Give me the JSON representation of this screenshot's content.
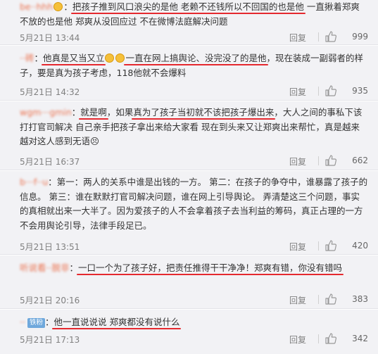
{
  "comments": [
    {
      "username": "be··hhh",
      "text_pre": "：",
      "text_hl": "把孩子推到风口浪尖的是他 老赖不还钱所以不回国的也是他",
      "text_post": " 一直揪着郑爽不放的也是他 郑爽从没回应过 不在微博法庭解决问题",
      "time": "5月21日 13:44",
      "reply": "回复",
      "likes": "999"
    },
    {
      "username": "··砖",
      "text_pre": "：",
      "text_hl1": "他真是又当又立",
      "text_hl2": "一直在网上搞舆论、没完没了的是他",
      "text_post": "，现在装成一副弱者的样子，要是真为孩子考虑，118他就不会爆料",
      "time": "5月21日 14:32",
      "reply": "回复",
      "likes": "935"
    },
    {
      "username": "wgm···gmin",
      "text_pre": "：",
      "text_hl1": "就是啊",
      "text_mid": "，如果",
      "text_hl2": "真为了孩子当初就不该把孩子爆出来",
      "text_post": "，大人之间的事私下该打打官司解决 自己亲手把孩子拿出来给大家看 现在到头来又让郑爽出来帮忙，真是越来越对这人感到无语😣",
      "time": "5月21日 16:37",
      "reply": "回复",
      "likes": "662"
    },
    {
      "username": "b···f··u",
      "text": "：第一：两人的关系中谁是出钱的一方。 第二：在孩子的争夺中，谁暴露了孩子的信息。 第三：谁在默默打官司解决问题，谁在网上引导舆论。 弄清楚这三个问题，事实的真相就出来一大半了。因为爱孩子的人不会拿着孩子去当利益的筹码，真正占理的一方不会用舆论引导，法律手段足已。",
      "time": "5月21日 13:51",
      "reply": "回复",
      "likes": "420"
    },
    {
      "username": "听说看··脱非",
      "text_pre": "：",
      "text_hl": "一口一个为了孩子好，把责任推得干干净净！郑爽有错，你没有错吗",
      "time": "5月21日 20:16",
      "reply": "回复",
      "likes": "383"
    },
    {
      "username": "··",
      "badge": "铁粉",
      "text_pre": "：",
      "text_hl": "他一直说说说 郑爽都没有说什么",
      "time": "5月21日 17:13",
      "reply": "回复",
      "likes": "342"
    }
  ],
  "colors": {
    "username": "#eb7350",
    "highlight_underline": "#e5292f",
    "card_bg": "#f2f2f5",
    "meta_text": "#808080"
  },
  "icons": [
    "thumbs-up-icon",
    "emoji-icon"
  ]
}
